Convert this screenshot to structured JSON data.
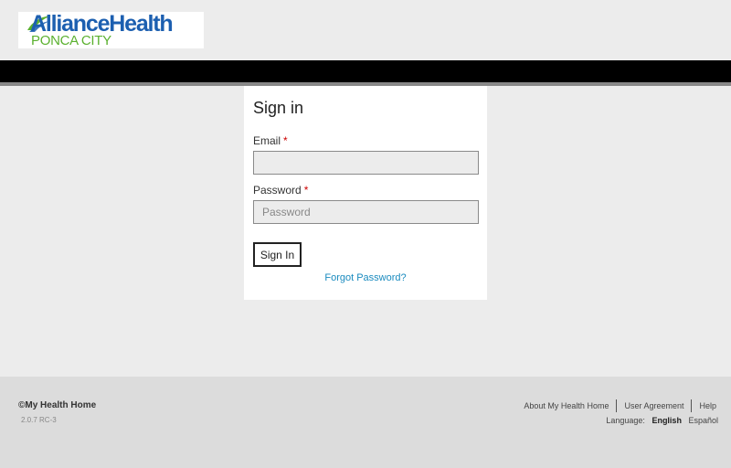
{
  "logo": {
    "main": "AllianceHealth",
    "sub": "PONCA CITY",
    "brand_blue": "#1c5fb0",
    "brand_green": "#5bb12f"
  },
  "colors": {
    "topbar": "#000000",
    "page_bg": "#ececec",
    "link": "#1a8bbf",
    "required": "#cc0000"
  },
  "signin": {
    "title": "Sign in",
    "email_label": "Email",
    "email_value": "",
    "password_label": "Password",
    "password_placeholder": "Password",
    "required_mark": "*",
    "button_label": "Sign In",
    "forgot_link": "Forgot Password?"
  },
  "footer": {
    "copyright": "©My Health Home",
    "version": "2.0.7 RC-3",
    "links": [
      "About My Health Home",
      "User Agreement",
      "Help"
    ],
    "language_label": "Language:",
    "languages": [
      "English",
      "Español"
    ],
    "selected_language": "English"
  }
}
